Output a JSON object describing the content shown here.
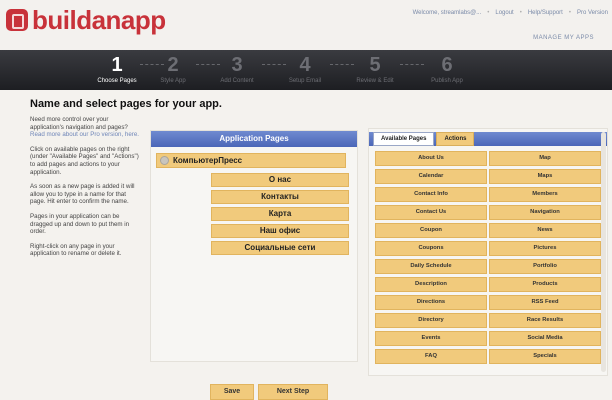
{
  "brand": {
    "part1": "build",
    "part2": "anapp"
  },
  "top_links": [
    "Welcome, streamlabs@...",
    "Logout",
    "Help/Support",
    "Pro Version"
  ],
  "manage_link": "MANAGE MY APPS",
  "steps": [
    {
      "num": "1",
      "label": "Choose Pages"
    },
    {
      "num": "2",
      "label": "Style App"
    },
    {
      "num": "3",
      "label": "Add Content"
    },
    {
      "num": "4",
      "label": "Setup Email"
    },
    {
      "num": "5",
      "label": "Review & Edit"
    },
    {
      "num": "6",
      "label": "Publish App"
    }
  ],
  "title": "Name and select pages for your app.",
  "help": {
    "p1_prefix": "Need more control over your application's navigation and pages?",
    "p1_link": "Read more about our Pro version, here.",
    "p2": "Click on available pages on the right (under \"Available Pages\" and \"Actions\") to add pages and actions to your application.",
    "p3": "As soon as a new page is added it will allow you to type in a name for that page. Hit enter to confirm the name.",
    "p4": "Pages in your application can be dragged up and down to put them in order.",
    "p5": "Right-click on any page in your application to rename or delete it."
  },
  "app_pages": {
    "header": "Application Pages",
    "root": "КомпьютерПресс",
    "pages": [
      "О нас",
      "Контакты",
      "Карта",
      "Наш офис",
      "Социальные сети"
    ]
  },
  "available": {
    "tabs": [
      "Available Pages",
      "Actions"
    ],
    "left": [
      "About Us",
      "Calendar",
      "Contact Info",
      "Contact Us",
      "Coupon",
      "Coupons",
      "Daily Schedule",
      "Description",
      "Directions",
      "Directory",
      "Events",
      "FAQ"
    ],
    "right": [
      "Map",
      "Maps",
      "Members",
      "Navigation",
      "News",
      "Pictures",
      "Portfolio",
      "Products",
      "RSS Feed",
      "Race Results",
      "Social Media",
      "Specials"
    ]
  },
  "buttons": {
    "save": "Save",
    "next": "Next Step"
  }
}
